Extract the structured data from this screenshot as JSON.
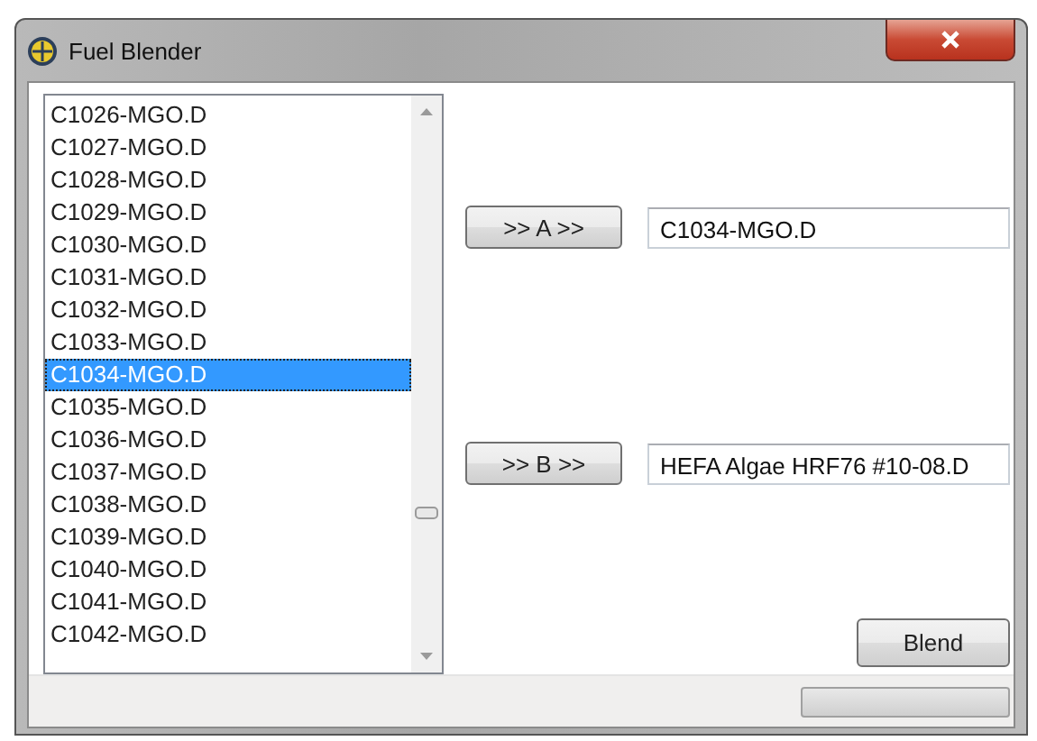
{
  "window": {
    "title": "Fuel Blender"
  },
  "list": {
    "items": [
      {
        "label": "C1026-MGO.D",
        "selected": false
      },
      {
        "label": "C1027-MGO.D",
        "selected": false
      },
      {
        "label": "C1028-MGO.D",
        "selected": false
      },
      {
        "label": "C1029-MGO.D",
        "selected": false
      },
      {
        "label": "C1030-MGO.D",
        "selected": false
      },
      {
        "label": "C1031-MGO.D",
        "selected": false
      },
      {
        "label": "C1032-MGO.D",
        "selected": false
      },
      {
        "label": "C1033-MGO.D",
        "selected": false
      },
      {
        "label": "C1034-MGO.D",
        "selected": true
      },
      {
        "label": "C1035-MGO.D",
        "selected": false
      },
      {
        "label": "C1036-MGO.D",
        "selected": false
      },
      {
        "label": "C1037-MGO.D",
        "selected": false
      },
      {
        "label": "C1038-MGO.D",
        "selected": false
      },
      {
        "label": "C1039-MGO.D",
        "selected": false
      },
      {
        "label": "C1040-MGO.D",
        "selected": false
      },
      {
        "label": "C1041-MGO.D",
        "selected": false
      },
      {
        "label": "C1042-MGO.D",
        "selected": false
      }
    ]
  },
  "assign": [
    {
      "button": ">> A >>",
      "value": "C1034-MGO.D"
    },
    {
      "button": ">> B >>",
      "value": "HEFA Algae HRF76 #10-08.D"
    }
  ],
  "blend_button": "Blend",
  "status_bar": {
    "progress": {
      "level": 0
    }
  }
}
